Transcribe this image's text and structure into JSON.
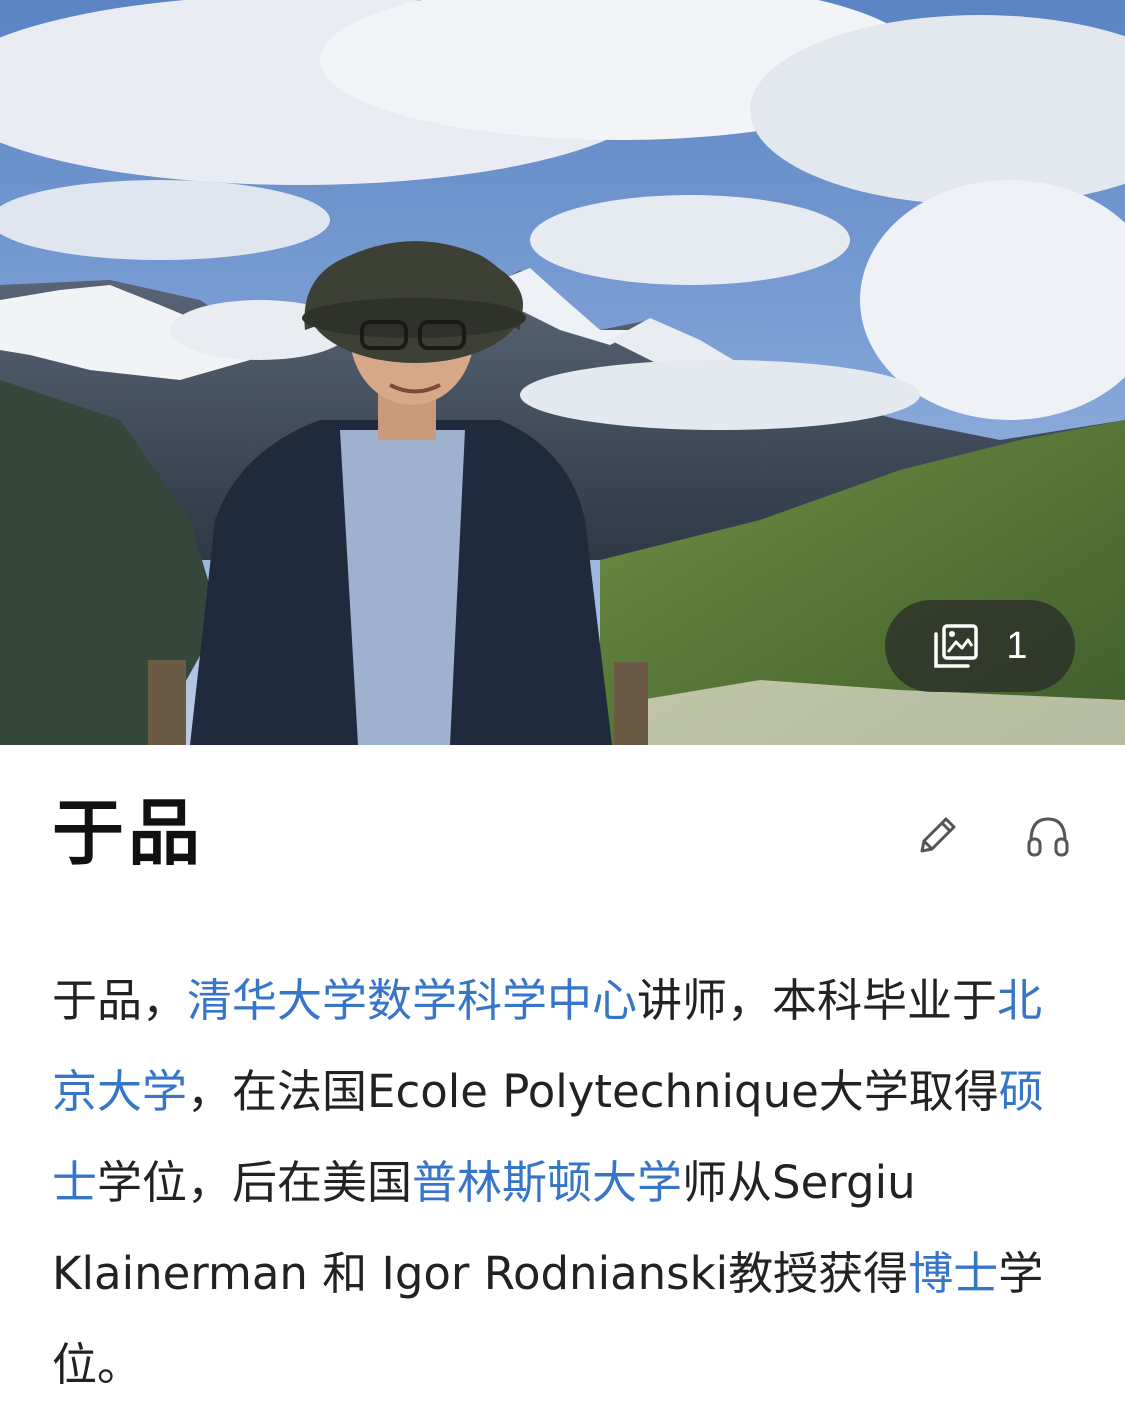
{
  "hero": {
    "image_label": "",
    "gallery_count": "1",
    "gallery_icon": "image-gallery-icon"
  },
  "entry": {
    "title": "于品",
    "edit_icon": "pencil-icon",
    "listen_icon": "headphones-icon"
  },
  "summary": {
    "t1": "于品，",
    "link_tsinghua": "清华大学数学科学中心",
    "t2": "讲师，本科毕业于",
    "link_pku": "北京大学",
    "t3": "，在法国Ecole Polytechnique大学取得",
    "link_masters": "硕士",
    "t4": "学位，后在美国",
    "link_princeton": "普林斯顿大学",
    "t5": "师从Sergiu Klainerman 和 Igor Rodnianski教授获得",
    "link_phd": "博士",
    "t6": "学位。"
  },
  "colors": {
    "link": "#3775c8",
    "text": "#222222",
    "badge_bg": "rgba(40,40,40,0.72)"
  }
}
